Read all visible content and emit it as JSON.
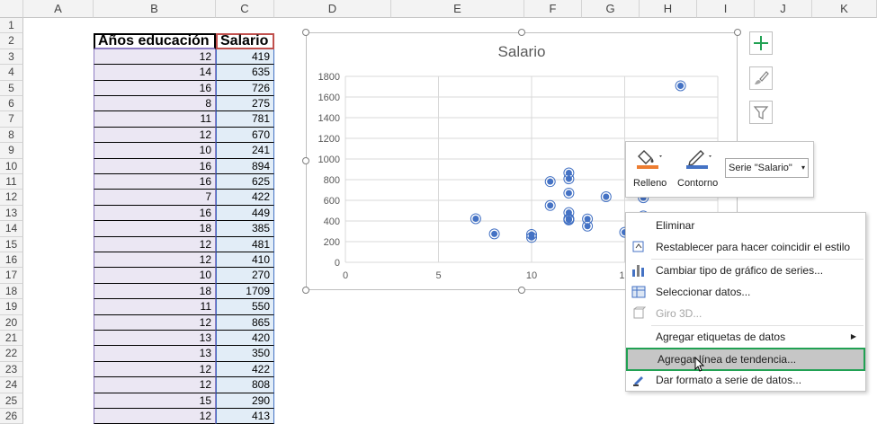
{
  "columns": [
    "A",
    "B",
    "C",
    "D",
    "E",
    "F",
    "G",
    "H",
    "I",
    "J",
    "K"
  ],
  "rows": [
    "1",
    "2",
    "3",
    "4",
    "5",
    "6",
    "7",
    "8",
    "9",
    "10",
    "11",
    "12",
    "13",
    "14",
    "15",
    "16",
    "17",
    "18",
    "19",
    "20",
    "21",
    "22",
    "23",
    "24",
    "25",
    "26"
  ],
  "table": {
    "header_b": "Años educación",
    "header_c": "Salario",
    "years": [
      "12",
      "14",
      "16",
      "8",
      "11",
      "12",
      "10",
      "16",
      "16",
      "7",
      "16",
      "18",
      "12",
      "12",
      "10",
      "18",
      "11",
      "12",
      "13",
      "13",
      "12",
      "12",
      "15",
      "12"
    ],
    "salary": [
      "419",
      "635",
      "726",
      "275",
      "781",
      "670",
      "241",
      "894",
      "625",
      "422",
      "449",
      "385",
      "481",
      "410",
      "270",
      "1709",
      "550",
      "865",
      "420",
      "350",
      "422",
      "808",
      "290",
      "413"
    ]
  },
  "chart_data": {
    "type": "scatter",
    "title": "Salario",
    "xlim": [
      0,
      20
    ],
    "ylim": [
      0,
      1800
    ],
    "x_ticks": [
      "0",
      "5",
      "10",
      "15"
    ],
    "y_ticks": [
      "0",
      "200",
      "400",
      "600",
      "800",
      "1000",
      "1200",
      "1400",
      "1600",
      "1800"
    ],
    "grid": true,
    "series": [
      {
        "name": "Salario",
        "color": "#4472c4",
        "x": [
          12,
          14,
          16,
          8,
          11,
          12,
          10,
          16,
          16,
          7,
          16,
          18,
          12,
          12,
          10,
          18,
          11,
          12,
          13,
          13,
          12,
          12,
          15,
          12
        ],
        "y": [
          419,
          635,
          726,
          275,
          781,
          670,
          241,
          894,
          625,
          422,
          449,
          385,
          481,
          410,
          270,
          1709,
          550,
          865,
          420,
          350,
          422,
          808,
          290,
          413
        ]
      }
    ]
  },
  "mini_toolbar": {
    "fill_label": "Relleno",
    "outline_label": "Contorno",
    "series_select": "Serie \"Salario\"",
    "fill_color": "#ed7d31",
    "outline_color": "#4472c4"
  },
  "context_menu": {
    "items": [
      {
        "label": "Eliminar",
        "icon": "delete-icon",
        "enabled": true
      },
      {
        "label": "Restablecer para hacer coincidir el estilo",
        "icon": "reset-style-icon",
        "enabled": true
      },
      {
        "label": "Cambiar tipo de gráfico de series...",
        "icon": "chart-type-icon",
        "enabled": true
      },
      {
        "label": "Seleccionar datos...",
        "icon": "select-data-icon",
        "enabled": true
      },
      {
        "label": "Giro 3D...",
        "icon": "rotation-3d-icon",
        "enabled": false
      },
      {
        "label": "Agregar etiquetas de datos",
        "icon": "",
        "enabled": true
      },
      {
        "label": "Agregar línea de tendencia...",
        "icon": "",
        "enabled": true
      },
      {
        "label": "Dar formato a serie de datos...",
        "icon": "format-series-icon",
        "enabled": true
      }
    ]
  },
  "highlight_color": "#21a153",
  "hover_color": "#c6c6c6"
}
